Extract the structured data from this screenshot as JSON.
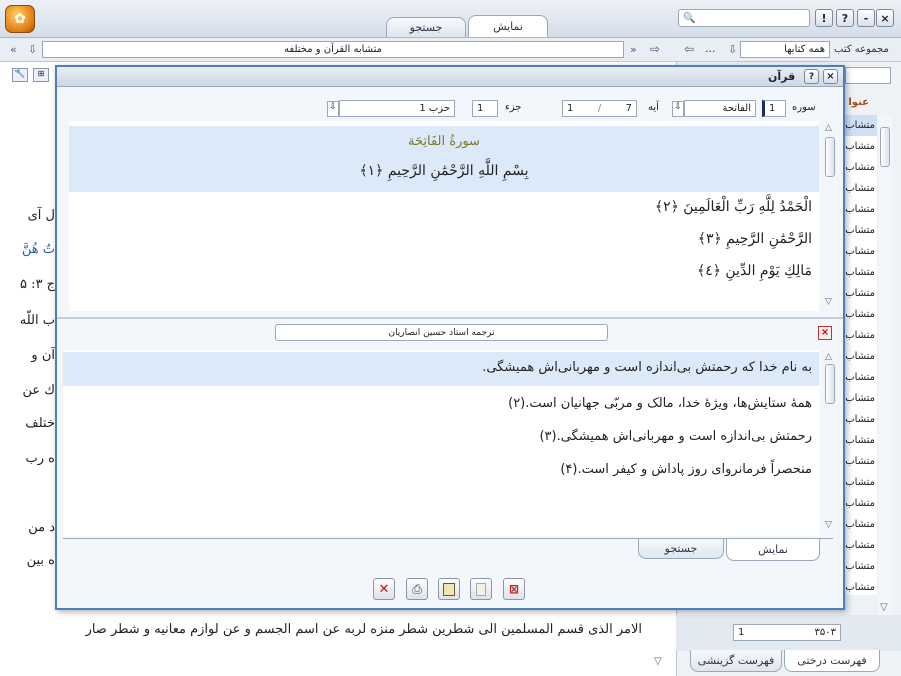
{
  "topbar": {
    "tabs": [
      "نمایش",
      "جستجو"
    ],
    "search_value": "",
    "window_buttons": [
      "!",
      "?",
      "-",
      "×"
    ]
  },
  "addressbar": {
    "path": "متشابه القرآن و مختلفه",
    "collection_label": "مجموعه کتب",
    "collection_value": "همه کتابها",
    "dots": "..."
  },
  "background": {
    "left_lines": [
      "ل آی",
      "تٌ هُنَّ",
      "ج ۳: ۵",
      "ب اللّه",
      "آن و",
      "ك عن",
      "ختلف",
      "ه رب",
      "د من",
      "ه بين"
    ],
    "bottom_line": "الامر الذی قسم المسلمين الی شطرين شطر منزه لربه عن اسم الجسم و عن لوازم معانيه و شطر صار",
    "right_header": "عنوا",
    "right_items": [
      "متشاب",
      "متشاب",
      "متشاب",
      "متشاب",
      "متشاب",
      "متشاب",
      "متشاب",
      "متشاب",
      "متشاب",
      "متشاب",
      "متشاب",
      "متشاب",
      "متشاب",
      "متشاب",
      "متشاب",
      "متشاب",
      "متشاب",
      "متشاب",
      "متشاب",
      "متشاب",
      "متشاب",
      "متشاب",
      "متشاب"
    ],
    "page_field": "۳۵۰۳",
    "page_num": "1",
    "bottom_tabs": [
      "فهرست درختی",
      "فهرست گزینشی"
    ]
  },
  "dialog": {
    "title": "قرآن",
    "surah_label": "سوره",
    "surah_num": "1",
    "surah_name": "الفاتحة",
    "aya_label": "آیه",
    "aya_value": "1",
    "aya_total": "7",
    "juz_label": "جزء",
    "juz_value": "1",
    "hizb_value": "حزب 1",
    "surah_title": "سورةُ الفَاتِحَة",
    "verses": [
      "بِسْمِ اللَّهِ الرَّحْمَٰنِ الرَّحِيمِ ﴿١﴾",
      "الْحَمْدُ لِلَّهِ رَبِّ الْعَالَمِينَ ﴿٢﴾",
      "الرَّحْمَٰنِ الرَّحِيمِ ﴿٣﴾",
      "مَالِكِ يَوْمِ الدِّينِ ﴿٤﴾"
    ],
    "translator": "ترجمه استاد حسين انصاريان",
    "translations": [
      "به نام خدا که رحمتش بی‌اندازه است و مهربانی‌اش همیشگی.",
      "همهٔ ستایش‌ها، ویژهٔ خدا، مالک و مربّی جهانیان است.(۲)",
      "رحمتش بی‌اندازه است و مهربانی‌اش همیشگی.(۳)",
      "منحصراً فرمانروای روز پاداش و کیفر است.(۴)"
    ],
    "tabs": [
      "نمایش",
      "جستجو"
    ]
  }
}
